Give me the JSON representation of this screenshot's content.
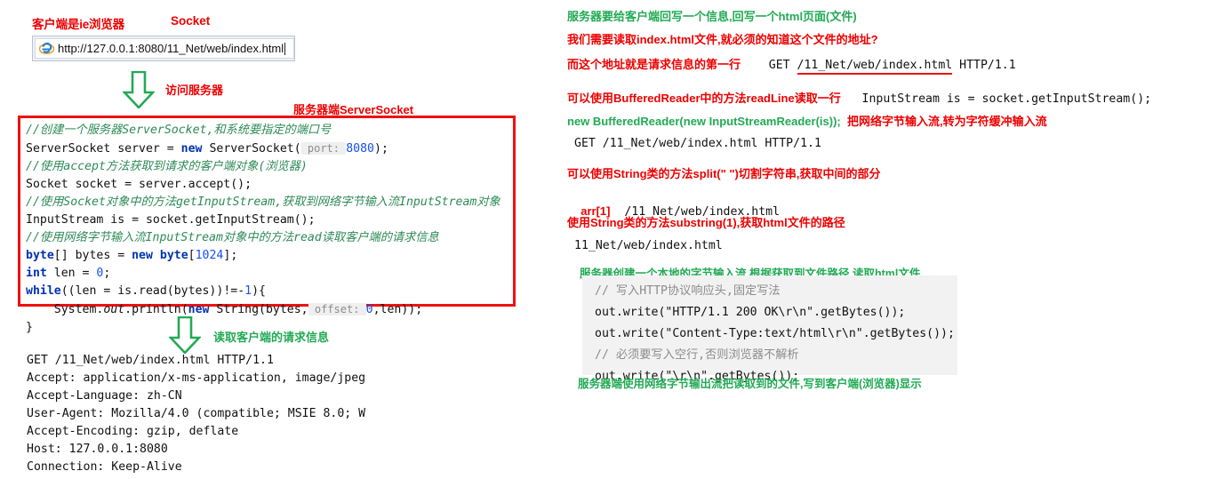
{
  "left": {
    "label_client": "客户端是ie浏览器",
    "label_socket": "Socket",
    "browser": {
      "icon": "ie-browser-icon",
      "url": "http://127.0.0.1:8080/11_Net/web/index.html"
    },
    "arrow1_label": "访问服务器",
    "label_server_socket": "服务器端ServerSocket",
    "code_lines": [
      "//创建一个服务器ServerSocket,和系统要指定的端口号",
      "ServerSocket server = new ServerSocket( port: 8080);",
      "//使用accept方法获取到请求的客户端对象(浏览器)",
      "Socket socket = server.accept();",
      "//使用Socket对象中的方法getInputStream,获取到网络字节输入流InputStream对象",
      "InputStream is = socket.getInputStream();",
      "//使用网络字节输入流InputStream对象中的方法read读取客户端的请求信息",
      "byte[] bytes = new byte[1024];",
      "int len = 0;",
      "while((len = is.read(bytes))!=-1){",
      "    System.out.println(new String(bytes, offset: 0,len));",
      "}"
    ],
    "arrow2_label": "读取客户端的请求信息",
    "request_dump": "GET /11_Net/web/index.html HTTP/1.1\nAccept: application/x-ms-application, image/jpeg\nAccept-Language: zh-CN\nUser-Agent: Mozilla/4.0 (compatible; MSIE 8.0; W\nAccept-Encoding: gzip, deflate\nHost: 127.0.0.1:8080\nConnection: Keep-Alive"
  },
  "right": {
    "line1": "服务器要给客户端回写一个信息,回写一个html页面(文件)",
    "line2": "我们需要读取index.html文件,就必须的知道这个文件的地址?",
    "line3_label": "而这个地址就是请求信息的第一行",
    "line3_code_pre": "GET ",
    "line3_code_ul": "/11_Net/web/index.html",
    "line3_code_post": " HTTP/1.1",
    "line4_label": "可以使用BufferedReader中的方法readLine读取一行",
    "line4_code": "InputStream is = socket.getInputStream();",
    "line5_code": "new BufferedReader(new InputStreamReader(is));",
    "line5_label": "把网络字节输入流,转为字符缓冲输入流",
    "line6_code": "GET /11_Net/web/index.html HTTP/1.1",
    "line7_label": "可以使用String类的方法split(\" \")切割字符串,获取中间的部分",
    "line8_prefix": "arr[1]",
    "line8_code": "/11_Net/web/index.html",
    "line9_label": "使用String类的方法substring(1),获取html文件的路径",
    "line10_code": "11_Net/web/index.html",
    "line11_label": "服务器创建一个本地的字节输入流,根据获取到文件路径,读取html文件",
    "gray_code": [
      "// 写入HTTP协议响应头,固定写法",
      "out.write(\"HTTP/1.1 200 OK\\r\\n\".getBytes());",
      "out.write(\"Content-Type:text/html\\r\\n\".getBytes());",
      "// 必须要写入空行,否则浏览器不解析",
      "out.write(\"\\r\\n\".getBytes());"
    ],
    "line12_label": "服务器端使用网络字节输出流把读取到的文件,写到客户端(浏览器)显示"
  },
  "colors": {
    "red": "#ee0000",
    "green": "#22aa55",
    "code_comment": "#2e8b57",
    "code_keyword": "#0033b3",
    "box_border": "#ee1111",
    "gray_panel": "#f2f2f2"
  }
}
